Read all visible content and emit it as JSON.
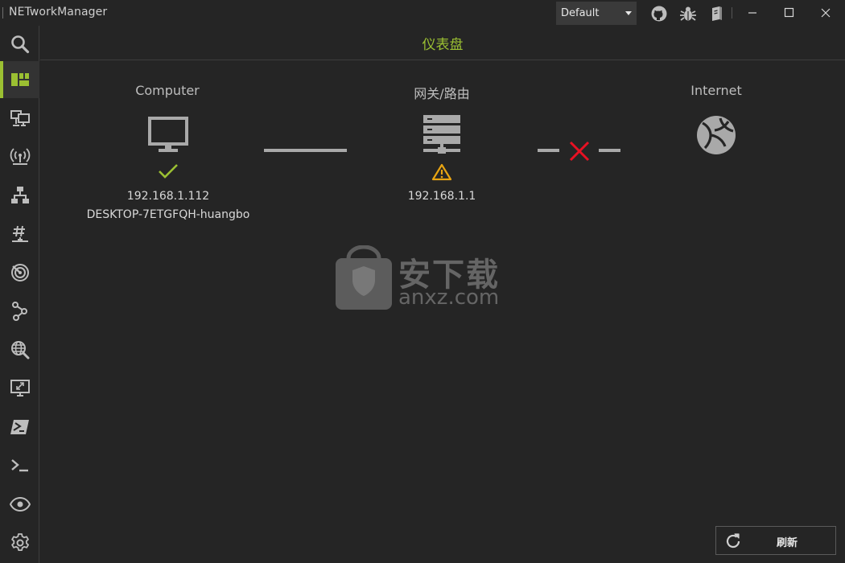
{
  "window": {
    "title": "NETworkManager"
  },
  "toolbar": {
    "profile_selected": "Default"
  },
  "page": {
    "heading": "仪表盘"
  },
  "dashboard": {
    "computer": {
      "label": "Computer",
      "ip": "192.168.1.112",
      "hostname": "DESKTOP-7ETGFQH-huangbo",
      "status": "ok"
    },
    "gateway": {
      "label": "网关/路由",
      "ip": "192.168.1.1",
      "status": "warning"
    },
    "internet": {
      "label": "Internet",
      "status": "failed"
    }
  },
  "actions": {
    "refresh_label": "刷新"
  },
  "watermark": {
    "text": "安下载",
    "domain": "anxz.com"
  },
  "colors": {
    "accent": "#9bc032",
    "ok": "#9bc032",
    "warning": "#e8a412",
    "error": "#e81123",
    "icon": "#a9a9a9"
  },
  "sidebar": {
    "items": [
      {
        "icon": "search-icon"
      },
      {
        "icon": "dashboard-icon",
        "active": true
      },
      {
        "icon": "network-interface-icon"
      },
      {
        "icon": "wifi-antenna-icon"
      },
      {
        "icon": "lan-topology-icon"
      },
      {
        "icon": "subnet-hash-icon"
      },
      {
        "icon": "radar-icon"
      },
      {
        "icon": "traceroute-icon"
      },
      {
        "icon": "dns-globe-icon"
      },
      {
        "icon": "remote-desktop-icon"
      },
      {
        "icon": "powershell-icon"
      },
      {
        "icon": "terminal-icon"
      },
      {
        "icon": "eye-icon"
      },
      {
        "icon": "settings-gear-icon"
      }
    ]
  }
}
